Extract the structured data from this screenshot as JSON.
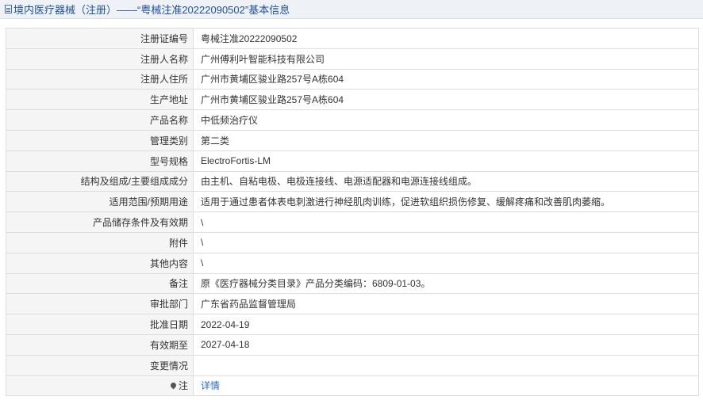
{
  "header": {
    "title": "境内医疗器械（注册）——“粤械注准20222090502”基本信息",
    "icon": "document-icon"
  },
  "rows": [
    {
      "label": "注册证编号",
      "value": "粤械注准20222090502"
    },
    {
      "label": "注册人名称",
      "value": "广州傅利叶智能科技有限公司"
    },
    {
      "label": "注册人住所",
      "value": "广州市黄埔区骏业路257号A栋604"
    },
    {
      "label": "生产地址",
      "value": "广州市黄埔区骏业路257号A栋604"
    },
    {
      "label": "产品名称",
      "value": "中低频治疗仪"
    },
    {
      "label": "管理类别",
      "value": "第二类"
    },
    {
      "label": "型号规格",
      "value": "ElectroFortis-LM"
    },
    {
      "label": "结构及组成/主要组成成分",
      "value": "由主机、自粘电极、电极连接线、电源适配器和电源连接线组成。"
    },
    {
      "label": "适用范围/预期用途",
      "value": "适用于通过患者体表电刺激进行神经肌肉训练，促进软组织损伤修复、缓解疼痛和改善肌肉萎缩。"
    },
    {
      "label": "产品储存条件及有效期",
      "value": "\\"
    },
    {
      "label": "附件",
      "value": "\\"
    },
    {
      "label": "其他内容",
      "value": "\\"
    },
    {
      "label": "备注",
      "value": "原《医疗器械分类目录》产品分类编码：6809-01-03。"
    },
    {
      "label": "审批部门",
      "value": "广东省药品监督管理局"
    },
    {
      "label": "批准日期",
      "value": "2022-04-19"
    },
    {
      "label": "有效期至",
      "value": "2027-04-18"
    },
    {
      "label": "变更情况",
      "value": ""
    }
  ],
  "note": {
    "label": "注",
    "icon": "pin-icon",
    "link_text": "详情"
  },
  "colors": {
    "title_text": "#1f4f99",
    "title_bg": "#eef2f7",
    "label_bg": "#f5f5f5",
    "border": "#dcdcdc",
    "link": "#2b6cc4"
  }
}
